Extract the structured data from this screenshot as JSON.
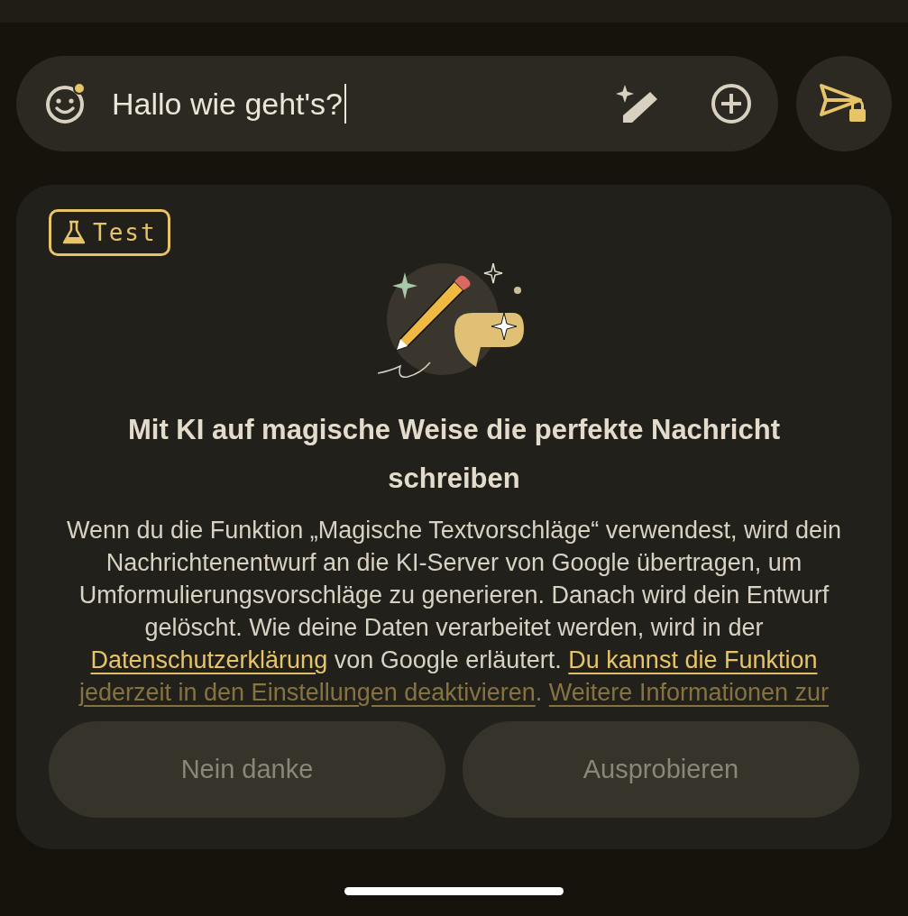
{
  "compose": {
    "value": "Hallo wie geht's?"
  },
  "card": {
    "badge": "Test",
    "title": "Mit KI auf magische Weise die perfekte Nachricht schreiben",
    "paragraph": [
      {
        "kind": "text",
        "text": "Wenn du die Funktion „Magische Textvorschläge“ verwendest, wird dein Nachrichtenentwurf an die KI-Server von Google übertragen, um Umformulierungsvorschläge zu generieren. Danach wird dein Entwurf gelöscht. Wie deine Daten verarbeitet werden, wird in der "
      },
      {
        "kind": "link",
        "text": "Datenschutzerklärung"
      },
      {
        "kind": "text",
        "text": " von Google erläutert. "
      },
      {
        "kind": "link",
        "text": "Du kannst die Funktion"
      },
      {
        "kind": "link",
        "text": "jederzeit in den Einstellungen deaktivieren"
      },
      {
        "kind": "text",
        "text": ". "
      },
      {
        "kind": "link",
        "text": "Weitere Informationen zur"
      }
    ],
    "buttons": [
      {
        "label": "Nein danke",
        "disabled": true
      },
      {
        "label": "Ausprobieren",
        "disabled": true
      }
    ]
  }
}
